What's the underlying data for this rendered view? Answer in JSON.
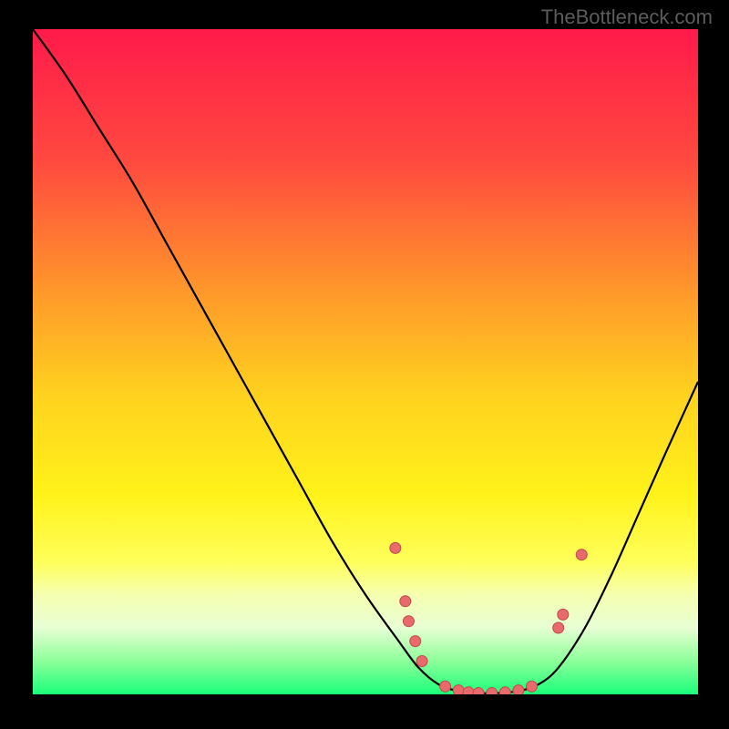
{
  "watermark": "TheBottleneck.com",
  "chart_data": {
    "type": "line",
    "title": "",
    "xlabel": "",
    "ylabel": "",
    "xlim": [
      0,
      100
    ],
    "ylim": [
      0,
      100
    ],
    "grid": false,
    "legend": false,
    "gradient_stops": [
      {
        "offset": 0,
        "color": "#ff1a4a"
      },
      {
        "offset": 0.2,
        "color": "#ff4a3f"
      },
      {
        "offset": 0.4,
        "color": "#ff9a2a"
      },
      {
        "offset": 0.55,
        "color": "#ffd21f"
      },
      {
        "offset": 0.7,
        "color": "#fff21a"
      },
      {
        "offset": 0.8,
        "color": "#ffff5a"
      },
      {
        "offset": 0.85,
        "color": "#f6ffb0"
      },
      {
        "offset": 0.9,
        "color": "#e8ffd4"
      },
      {
        "offset": 0.95,
        "color": "#8cff9a"
      },
      {
        "offset": 1.0,
        "color": "#1aff7a"
      }
    ],
    "curve": [
      {
        "x": 0,
        "y": 100
      },
      {
        "x": 5,
        "y": 93
      },
      {
        "x": 10,
        "y": 85
      },
      {
        "x": 15,
        "y": 77
      },
      {
        "x": 20,
        "y": 68
      },
      {
        "x": 25,
        "y": 59
      },
      {
        "x": 30,
        "y": 50
      },
      {
        "x": 35,
        "y": 41
      },
      {
        "x": 40,
        "y": 32
      },
      {
        "x": 45,
        "y": 23
      },
      {
        "x": 50,
        "y": 15
      },
      {
        "x": 55,
        "y": 8
      },
      {
        "x": 58,
        "y": 4
      },
      {
        "x": 61,
        "y": 1.5
      },
      {
        "x": 64,
        "y": 0.5
      },
      {
        "x": 67,
        "y": 0.2
      },
      {
        "x": 70,
        "y": 0.2
      },
      {
        "x": 73,
        "y": 0.5
      },
      {
        "x": 76,
        "y": 1.5
      },
      {
        "x": 79,
        "y": 4
      },
      {
        "x": 83,
        "y": 10
      },
      {
        "x": 87,
        "y": 18
      },
      {
        "x": 91,
        "y": 27
      },
      {
        "x": 95,
        "y": 36
      },
      {
        "x": 100,
        "y": 47
      }
    ],
    "points": [
      {
        "x": 54.5,
        "y": 22
      },
      {
        "x": 56,
        "y": 14
      },
      {
        "x": 56.5,
        "y": 11
      },
      {
        "x": 57.5,
        "y": 8
      },
      {
        "x": 58.5,
        "y": 5
      },
      {
        "x": 62,
        "y": 1.2
      },
      {
        "x": 64,
        "y": 0.6
      },
      {
        "x": 65.5,
        "y": 0.3
      },
      {
        "x": 67,
        "y": 0.2
      },
      {
        "x": 69,
        "y": 0.2
      },
      {
        "x": 71,
        "y": 0.3
      },
      {
        "x": 73,
        "y": 0.6
      },
      {
        "x": 75,
        "y": 1.2
      },
      {
        "x": 79,
        "y": 10
      },
      {
        "x": 79.7,
        "y": 12
      },
      {
        "x": 82.5,
        "y": 21
      }
    ],
    "point_style": {
      "fill": "#e86a6a",
      "stroke": "#c04a4a",
      "radius": 6
    }
  }
}
